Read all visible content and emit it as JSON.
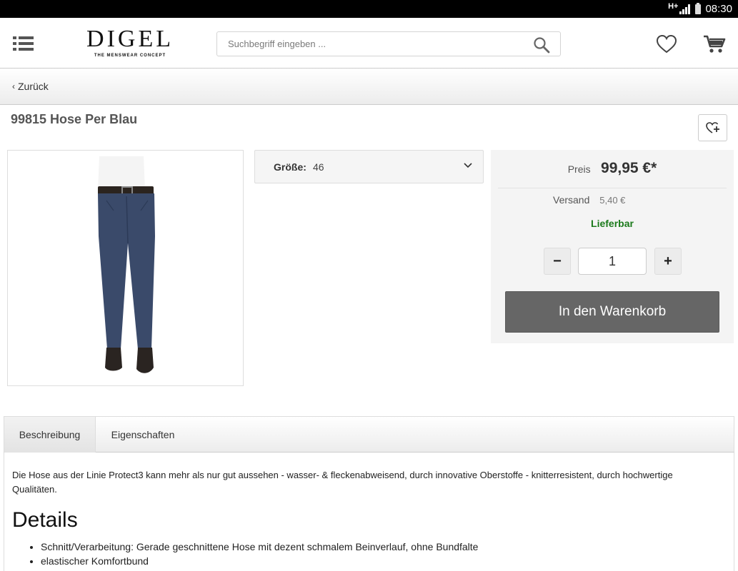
{
  "status_bar": {
    "network": "H+",
    "time": "08:30"
  },
  "header": {
    "logo_text": "DIGEL",
    "logo_tagline": "THE MENSWEAR CONCEPT",
    "search_placeholder": "Suchbegriff eingeben ..."
  },
  "back": {
    "label": "Zurück"
  },
  "product": {
    "title": "99815 Hose Per Blau",
    "size_label": "Größe:",
    "size_value": "46",
    "price_label": "Preis",
    "price_value": "99,95 €*",
    "shipping_label": "Versand",
    "shipping_value": "5,40 €",
    "availability": "Lieferbar",
    "quantity": "1",
    "qty_minus": "−",
    "qty_plus": "+",
    "add_to_cart": "In den Warenkorb"
  },
  "tabs": [
    {
      "label": "Beschreibung"
    },
    {
      "label": "Eigenschaften"
    }
  ],
  "description": {
    "text": "Die Hose aus der Linie Protect3 kann mehr als nur gut aussehen - wasser- & fleckenabweisend, durch innovative Oberstoffe - knitterresistent, durch hochwertige Qualitäten.",
    "details_heading": "Details",
    "details": [
      "Schnitt/Verarbeitung: Gerade geschnittene Hose mit dezent schmalem Beinverlauf, ohne Bundfalte",
      "elastischer Komfortbund"
    ]
  },
  "colors": {
    "available": "#1b7a1b",
    "cart_button": "#666666",
    "trousers": "#3a4a6a"
  }
}
